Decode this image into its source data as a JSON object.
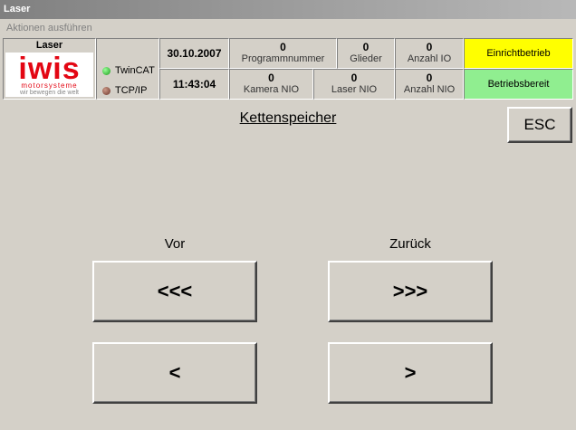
{
  "window": {
    "title": "Laser"
  },
  "menu": {
    "label": "Aktionen ausführen"
  },
  "header": {
    "station_label": "Laser",
    "logo": {
      "text": "iwis",
      "sub1": "motorsysteme",
      "sub2": "wir bewegen die welt",
      "color": "#e30613"
    },
    "indicators": [
      {
        "label": "TwinCAT",
        "color": "#22aa22"
      },
      {
        "label": "TCP/IP",
        "color": "#8b4a3a"
      }
    ],
    "date": "30.10.2007",
    "time": "11:43:04",
    "counters_top": [
      {
        "value": "0",
        "label": "Programmnummer"
      },
      {
        "value": "0",
        "label": "Glieder"
      },
      {
        "value": "0",
        "label": "Anzahl IO"
      }
    ],
    "counters_bottom": [
      {
        "value": "0",
        "label": "Kamera NIO"
      },
      {
        "value": "0",
        "label": "Laser NIO"
      },
      {
        "value": "0",
        "label": "Anzahl NIO"
      }
    ],
    "status": [
      {
        "label": "Einrichtbetrieb",
        "color": "#ffff00"
      },
      {
        "label": "Betriebsbereit",
        "color": "#90ee90"
      }
    ]
  },
  "main": {
    "heading": "Kettenspeicher",
    "esc_label": "ESC",
    "vor_label": "Vor",
    "zurueck_label": "Zurück",
    "buttons": {
      "vor_fast": "<<<",
      "zurueck_fast": ">>>",
      "vor_step": "<",
      "zurueck_step": ">"
    }
  }
}
